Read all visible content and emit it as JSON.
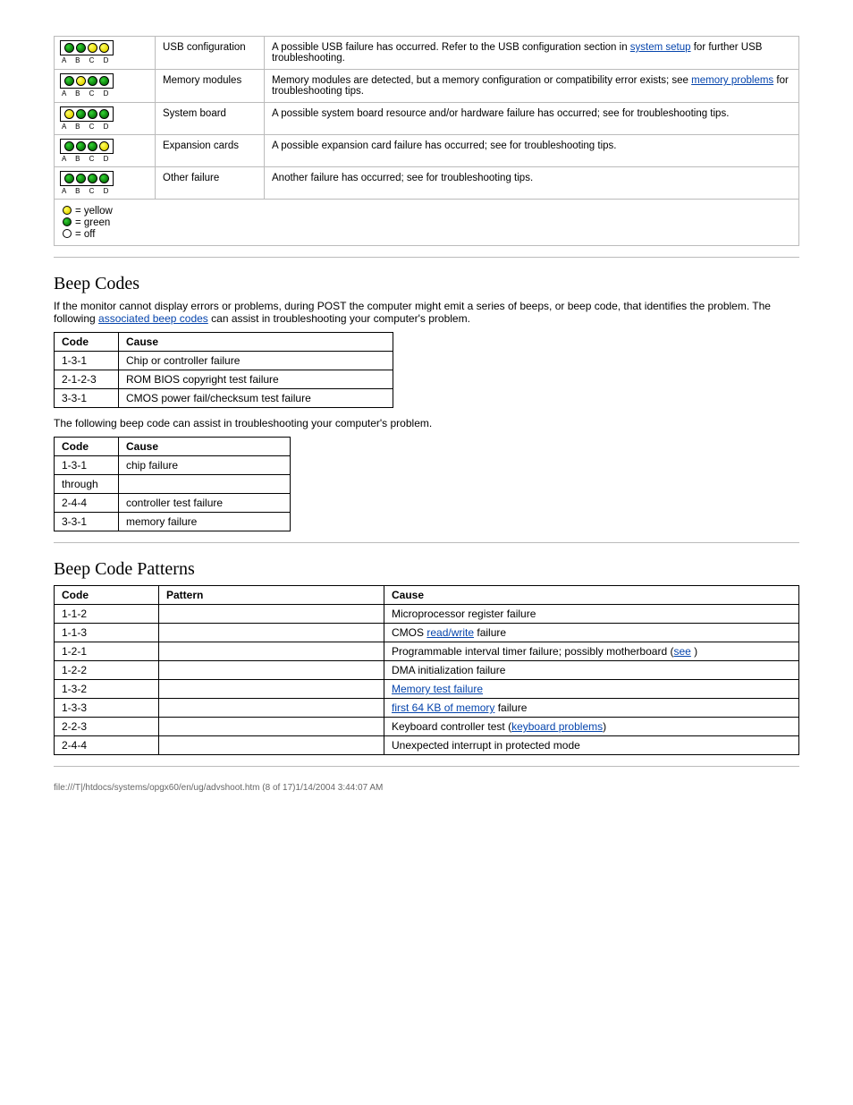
{
  "diag_rows": [
    {
      "leds": [
        "g",
        "g",
        "y",
        "y"
      ],
      "cause": "USB configuration",
      "text_before": "A possible USB failure has occurred. Refer to the USB configuration section in ",
      "link": "system setup",
      "text_after": " for further USB troubleshooting.",
      "link_after": null
    },
    {
      "leds": [
        "g",
        "y",
        "g",
        "g"
      ],
      "cause": "Memory modules",
      "text_before": "Memory modules are detected, but a memory configuration or compatibility error exists; see ",
      "link": "memory problems",
      "text_after": " for troubleshooting tips.",
      "link_after": null
    },
    {
      "leds": [
        "y",
        "g",
        "g",
        "g"
      ],
      "cause": "System board",
      "text_before": "A possible system board resource and/or hardware failure has occurred; see for ",
      "link": null,
      "text_after": "troubleshooting tips.",
      "link_after": null
    },
    {
      "leds": [
        "g",
        "g",
        "g",
        "y"
      ],
      "cause": "Expansion cards",
      "text_before": "A possible expansion card failure has occurred; see for troubleshooting tips.",
      "link": null,
      "text_after": "",
      "link_after": null
    },
    {
      "leds": [
        "g",
        "g",
        "g",
        "g"
      ],
      "cause": "Other failure",
      "text_before": "Another failure has occurred; see for troubleshooting tips.",
      "link": null,
      "text_after": "",
      "link_after": null
    }
  ],
  "led_labels": "A B C D",
  "legend": {
    "yellow": "= yellow",
    "green": "= green",
    "off": "= off"
  },
  "beep_section_title": "Beep Codes",
  "beep_intro1": "If the monitor cannot display errors or problems, during POST the computer might emit a series of beeps, or beep code, that identifies the problem. The following ",
  "beep_link": "associated beep codes",
  "beep_intro2": " can assist in troubleshooting your computer's problem.",
  "beep_table1": {
    "headers": [
      "Code",
      "Cause"
    ],
    "rows": [
      [
        "1-3-1",
        "Chip or controller failure"
      ],
      [
        "2-1-2-3",
        "ROM BIOS copyright test failure"
      ],
      [
        "3-3-1",
        "CMOS power fail/checksum test failure"
      ]
    ]
  },
  "beep_note": "The following beep code can assist in troubleshooting your computer's problem.",
  "beep_table2": {
    "headers": [
      "Code",
      "Cause"
    ],
    "rows": [
      [
        "1-3-1",
        "chip failure"
      ],
      [
        "through",
        ""
      ],
      [
        "2-4-4",
        "controller test failure"
      ],
      [
        "3-3-1",
        "memory failure"
      ]
    ]
  },
  "beepcode_section_title": "Beep Code Patterns",
  "pattern_table": {
    "headers": [
      "Code",
      "Pattern",
      "Cause"
    ],
    "rows": [
      [
        "1-1-2",
        "",
        "Microprocessor register failure"
      ],
      [
        "1-1-3",
        "",
        {
          "pre": "CMOS ",
          "link": "read/write",
          "post": " failure"
        }
      ],
      [
        "1-2-1",
        "",
        {
          "pre": "Programmable interval timer failure; possibly motherboard (",
          "link": "see",
          "post": " )"
        }
      ],
      [
        "1-2-2",
        "",
        "DMA initialization failure"
      ],
      [
        "1-3-2",
        "",
        {
          "pre": "",
          "link": "Memory test failure",
          "post": ""
        }
      ],
      [
        "1-3-3",
        "",
        {
          "pre": "",
          "link": "first 64 KB of memory",
          "post": " failure"
        }
      ],
      [
        "2-2-3",
        "",
        {
          "pre": "Keyboard controller test (",
          "link": "keyboard problems",
          "post": ")"
        }
      ],
      [
        "2-4-4",
        "",
        "Unexpected interrupt in protected mode"
      ]
    ]
  },
  "footer": "file:///T|/htdocs/systems/opgx60/en/ug/advshoot.htm (8 of 17)1/14/2004 3:44:07 AM"
}
